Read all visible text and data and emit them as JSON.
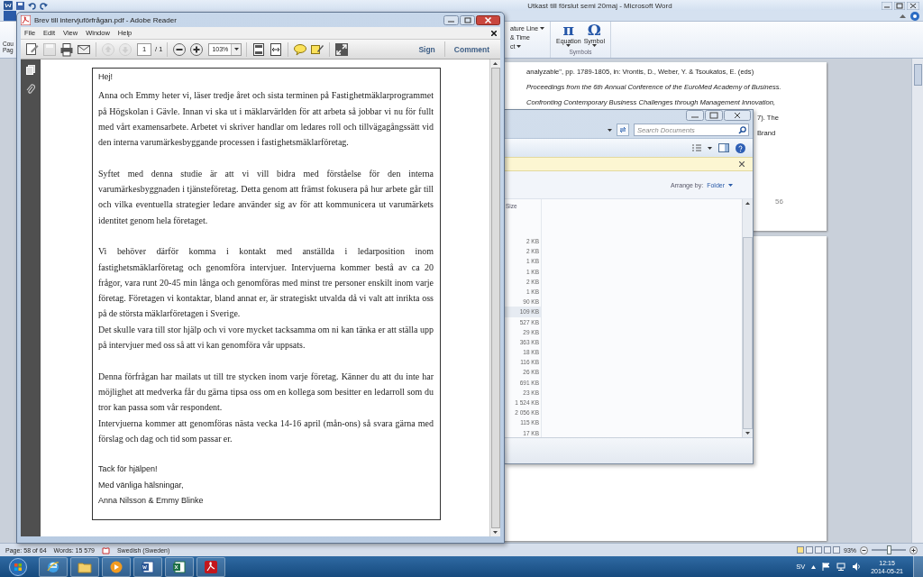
{
  "word": {
    "title": "Utkast till förslut semi 20maj - Microsoft Word",
    "left_fragments": [
      "Cou",
      "Pag"
    ],
    "insert_fragments": [
      {
        "text": "ature Line",
        "caret": true
      },
      {
        "text": "& Time",
        "caret": false
      },
      {
        "text": "ct",
        "caret": true
      }
    ],
    "symbols_group": {
      "buttons": [
        {
          "glyph": "π",
          "label": "Equation"
        },
        {
          "glyph": "Ω",
          "label": "Symbol"
        }
      ],
      "label": "Symbols"
    },
    "document": {
      "lines": [
        {
          "text": "analyzable\", pp. 1789-1805, in:  Vrontis,  D., Weber, Y. & Tsoukatos, E. (eds)",
          "italic": false
        },
        {
          "text": "Proceedings from the 6th Annual Conference of the EuroMed Academy of Business.",
          "italic": true
        },
        {
          "text": "Confronting Contemporary Business Challenges through Management Innovation,",
          "italic": true
        }
      ],
      "fragments": [
        "7). The",
        "Brand"
      ],
      "page_number": "56"
    },
    "status_bar": {
      "page": "Page: 58 of 64",
      "words": "Words: 15 579",
      "language": "Swedish (Sweden)",
      "zoom": "93%",
      "zoom_slider": {
        "level": 0.5
      }
    }
  },
  "explorer": {
    "search": {
      "placeholder": "Search Documents"
    },
    "arrange_label": "Arrange by:",
    "arrange_value": "Folder",
    "column": "Size",
    "rows": [
      {
        "size": "2 KB",
        "selected": false
      },
      {
        "size": "2 KB",
        "selected": false
      },
      {
        "size": "1 KB",
        "selected": false
      },
      {
        "size": "1 KB",
        "selected": false
      },
      {
        "size": "2 KB",
        "selected": false
      },
      {
        "size": "1 KB",
        "selected": false
      },
      {
        "size": "90 KB",
        "selected": false
      },
      {
        "size": "109 KB",
        "selected": true
      },
      {
        "size": "527 KB",
        "selected": false
      },
      {
        "size": "29 KB",
        "selected": false
      },
      {
        "size": "363 KB",
        "selected": false
      },
      {
        "size": "18 KB",
        "selected": false
      },
      {
        "size": "116 KB",
        "selected": false
      },
      {
        "size": "26 KB",
        "selected": false
      },
      {
        "size": "691 KB",
        "selected": false
      },
      {
        "size": "23 KB",
        "selected": false
      },
      {
        "size": "1 524 KB",
        "selected": false
      },
      {
        "size": "2 056 KB",
        "selected": false
      },
      {
        "size": "115 KB",
        "selected": false
      },
      {
        "size": "17 KB",
        "selected": false
      }
    ]
  },
  "adobe": {
    "title": "Brev till intervjuförfrågan.pdf - Adobe Reader",
    "menu": [
      "File",
      "Edit",
      "View",
      "Window",
      "Help"
    ],
    "tool_groups": [
      [
        {
          "kind": "edit",
          "disabled": false
        },
        {
          "kind": "save",
          "disabled": true
        },
        {
          "kind": "print",
          "disabled": false
        },
        {
          "kind": "email",
          "disabled": false
        }
      ],
      [
        {
          "kind": "prev",
          "disabled": true
        },
        {
          "kind": "next",
          "disabled": true
        },
        {
          "kind": "page_field",
          "disabled": false
        }
      ],
      [
        {
          "kind": "zoom_out",
          "disabled": false
        },
        {
          "kind": "zoom_in",
          "disabled": false
        },
        {
          "kind": "zoom_field",
          "disabled": false
        }
      ],
      [
        {
          "kind": "fit_page",
          "disabled": false
        },
        {
          "kind": "fit_width",
          "disabled": false
        }
      ],
      [
        {
          "kind": "comment",
          "disabled": false
        },
        {
          "kind": "highlight",
          "disabled": false
        }
      ],
      [
        {
          "kind": "expand",
          "disabled": false
        }
      ]
    ],
    "page": {
      "value": "1",
      "total": "/ 1"
    },
    "zoom": "103%",
    "actions": [
      "Sign",
      "Comment"
    ],
    "letter": [
      {
        "kind": "greeting",
        "space_before": false,
        "text": "Hej!"
      },
      {
        "kind": "body",
        "space_before": false,
        "text": "Anna och Emmy heter vi, läser tredje året och sista terminen på Fastighetmäklarprogrammet på Högskolan i Gävle. Innan vi ska ut i mäklarvärlden för att arbeta så jobbar vi nu för fullt med vårt examensarbete. Arbetet vi skriver handlar om ledares roll och tillvägagångssätt vid den interna varumärkesbyggande processen i fastighetsmäklarföretag."
      },
      {
        "kind": "body",
        "space_before": true,
        "text": "Syftet med denna studie är att vi vill bidra med förståelse för den interna varumärkesbyggnaden i tjänsteföretag. Detta genom att främst fokusera på hur arbete går till och vilka eventuella strategier ledare använder sig av för att kommunicera ut varumärkets identitet genom hela företaget."
      },
      {
        "kind": "body",
        "space_before": true,
        "text": "Vi behöver därför komma i kontakt med anställda i ledarposition inom fastighetsmäklarföretag och genomföra intervjuer. Intervjuerna kommer bestå av ca 20 frågor, vara runt 20-45 min långa och genomföras med minst tre personer enskilt inom varje företag. Företagen vi kontaktar, bland annat er, är strategiskt utvalda då vi valt att inrikta oss på de största mäklarföretagen i Sverige."
      },
      {
        "kind": "body",
        "space_before": false,
        "text": "Det skulle vara till stor hjälp och vi vore mycket tacksamma om ni kan tänka er att ställa upp på intervjuer med oss så att vi kan genomföra vår uppsats."
      },
      {
        "kind": "body",
        "space_before": true,
        "text": "Denna förfrågan har mailats ut till tre stycken inom varje företag. Känner du att du inte har möjlighet att medverka får du gärna tipsa oss om en kollega som besitter en ledarroll som du tror kan passa som vår respondent."
      },
      {
        "kind": "body",
        "space_before": false,
        "text": "Intervjuerna kommer att genomföras nästa vecka 14-16 april (mån-ons) så svara gärna med förslag och dag och tid som passar er."
      },
      {
        "kind": "signoff",
        "space_before": true,
        "text": "Tack för hjälpen!"
      },
      {
        "kind": "signoff",
        "space_before": false,
        "text": "Med vänliga hälsningar,"
      },
      {
        "kind": "signoff",
        "space_before": false,
        "text": "Anna Nilsson & Emmy Blinke"
      }
    ]
  },
  "taskbar": {
    "apps": [
      {
        "kind": "browser"
      },
      {
        "kind": "folder"
      },
      {
        "kind": "media"
      },
      {
        "kind": "word"
      },
      {
        "kind": "excel"
      },
      {
        "kind": "pdf"
      }
    ],
    "language": "SV",
    "time": "12:15",
    "date": "2014-05-21"
  }
}
